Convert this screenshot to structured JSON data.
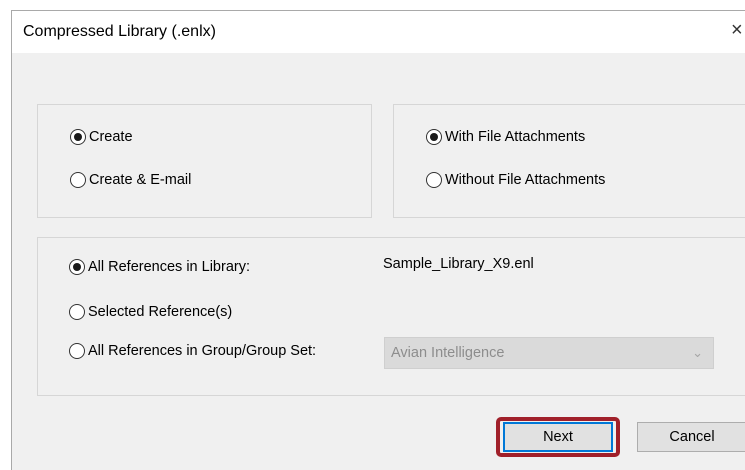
{
  "window": {
    "title": "Compressed Library (.enlx)",
    "close_glyph": "×"
  },
  "mode_group": {
    "create": {
      "label": "Create",
      "checked": true
    },
    "create_email": {
      "label": "Create & E-mail",
      "checked": false
    }
  },
  "attachments_group": {
    "with": {
      "label": "With File Attachments",
      "checked": true
    },
    "without": {
      "label": "Without File Attachments",
      "checked": false
    }
  },
  "references_group": {
    "all_in_library": {
      "label": "All References in Library:",
      "checked": true,
      "value": "Sample_Library_X9.enl"
    },
    "selected": {
      "label": "Selected Reference(s)",
      "checked": false
    },
    "group_set": {
      "label": "All References in Group/Group Set:",
      "checked": false,
      "selected_option": "Avian Intelligence",
      "enabled": false
    }
  },
  "buttons": {
    "next": "Next",
    "cancel": "Cancel"
  },
  "colors": {
    "dialog_bg": "#f0f0f0",
    "highlight_border": "#a0202a",
    "default_button_border": "#0078d7"
  },
  "icons": {
    "close": "close-icon",
    "dropdown": "chevron-down-icon"
  }
}
